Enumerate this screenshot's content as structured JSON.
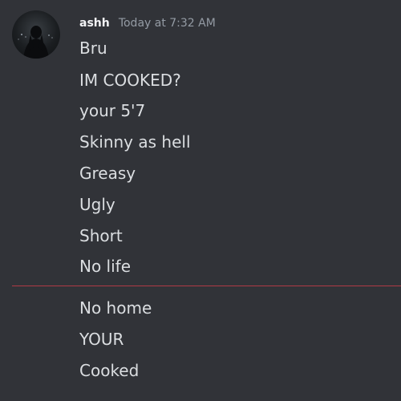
{
  "message": {
    "author": "ashh",
    "timestamp": "Today at 7:32 AM",
    "lines_before_divider": [
      "Bru",
      "IM COOKED?",
      "your 5'7",
      "Skinny as hell",
      "Greasy",
      "Ugly",
      "Short",
      "No life"
    ],
    "lines_after_divider": [
      "No home",
      "YOUR",
      "Cooked"
    ]
  },
  "colors": {
    "background": "#313338",
    "text": "#dbdee1",
    "username": "#f2f3f5",
    "timestamp": "#949ba4",
    "new_messages_divider": "#b03a45"
  },
  "icons": {
    "avatar": "user-avatar-photo"
  }
}
